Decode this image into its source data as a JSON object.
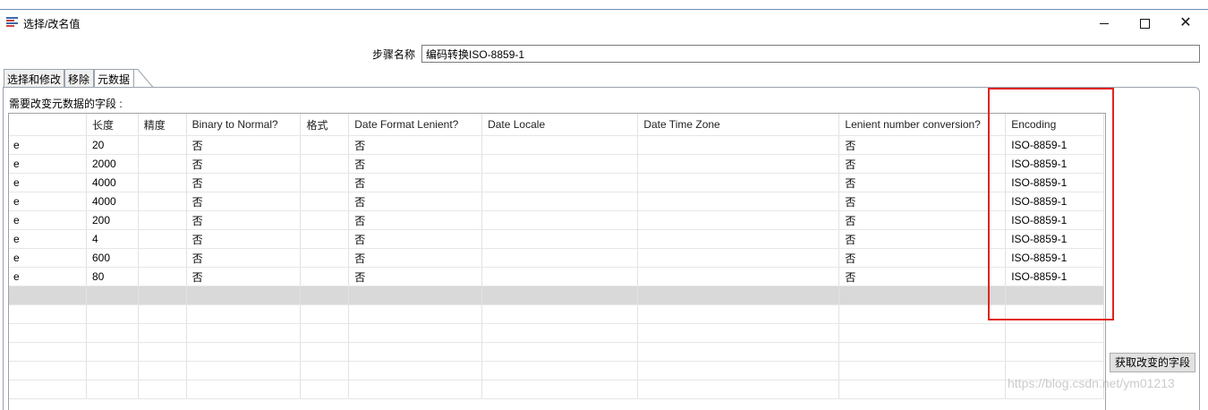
{
  "window": {
    "title": "选择/改名值",
    "minimize_icon": "minimize-icon",
    "maximize_icon": "maximize-icon",
    "close_icon": "close-icon"
  },
  "step": {
    "label": "步骤名称",
    "value": "编码转换ISO-8859-1"
  },
  "tabs": [
    {
      "label": "选择和修改"
    },
    {
      "label": "移除"
    },
    {
      "label": "元数据",
      "active": true
    }
  ],
  "panel": {
    "heading": "需要改变元数据的字段 :"
  },
  "table": {
    "columns": [
      "",
      "长度",
      "精度",
      "Binary to Normal?",
      "格式",
      "Date Format Lenient?",
      "Date Locale",
      "Date Time Zone",
      "Lenient number conversion?",
      "Encoding"
    ],
    "rows": [
      [
        "e",
        "20",
        "",
        "否",
        "",
        "否",
        "",
        "",
        "否",
        "ISO-8859-1"
      ],
      [
        "e",
        "2000",
        "",
        "否",
        "",
        "否",
        "",
        "",
        "否",
        "ISO-8859-1"
      ],
      [
        "e",
        "4000",
        "",
        "否",
        "",
        "否",
        "",
        "",
        "否",
        "ISO-8859-1"
      ],
      [
        "e",
        "4000",
        "",
        "否",
        "",
        "否",
        "",
        "",
        "否",
        "ISO-8859-1"
      ],
      [
        "e",
        "200",
        "",
        "否",
        "",
        "否",
        "",
        "",
        "否",
        "ISO-8859-1"
      ],
      [
        "e",
        "4",
        "",
        "否",
        "",
        "否",
        "",
        "",
        "否",
        "ISO-8859-1"
      ],
      [
        "e",
        "600",
        "",
        "否",
        "",
        "否",
        "",
        "",
        "否",
        "ISO-8859-1"
      ],
      [
        "e",
        "80",
        "",
        "否",
        "",
        "否",
        "",
        "",
        "否",
        "ISO-8859-1"
      ]
    ],
    "empty_rows": 6
  },
  "buttons": {
    "get_fields": "获取改变的字段"
  },
  "watermark": "https://blog.csdn.net/ym01213",
  "colors": {
    "highlight_box": "#e0231f",
    "selected_row": "#d9d9d9"
  }
}
